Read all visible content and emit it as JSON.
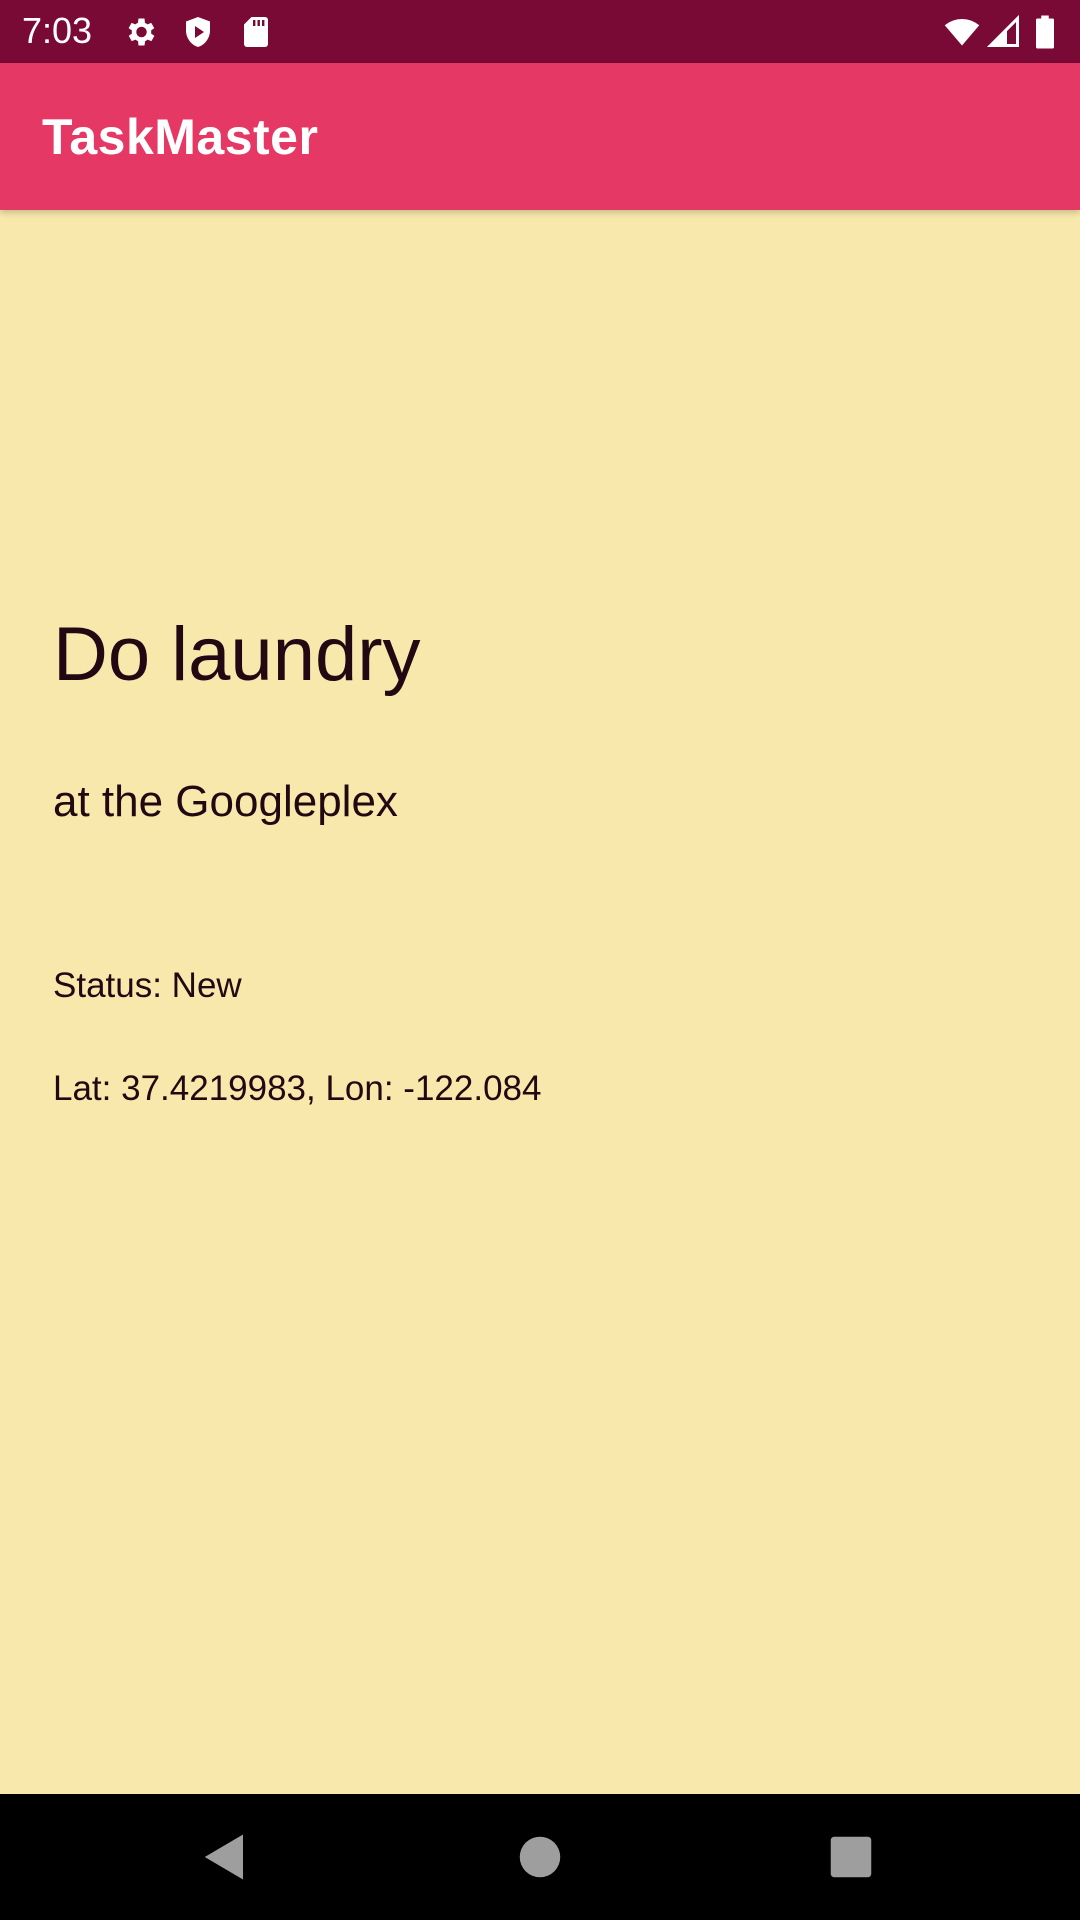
{
  "status_bar": {
    "time": "7:03",
    "icons_left": [
      "gear-icon",
      "shield-play-icon",
      "sd-card-icon"
    ],
    "icons_right": [
      "wifi-icon",
      "cell-signal-icon",
      "battery-icon"
    ],
    "background": "#790a35"
  },
  "app_bar": {
    "title": "TaskMaster",
    "background": "#e53864"
  },
  "task": {
    "title": "Do laundry",
    "location": "at the Googleplex",
    "status": "Status: New",
    "coordinates": "Lat: 37.4219983, Lon: -122.084"
  },
  "content": {
    "background": "#f8e8ab"
  },
  "nav_bar": {
    "buttons": [
      "back-icon",
      "home-icon",
      "recents-icon"
    ]
  }
}
